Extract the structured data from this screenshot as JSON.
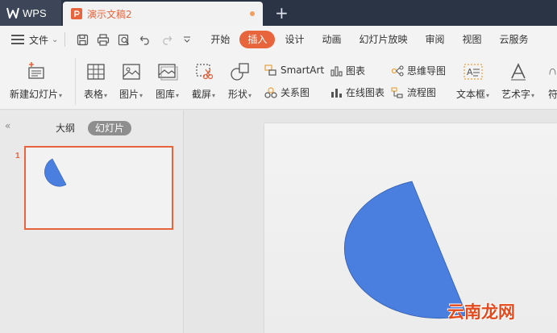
{
  "titlebar": {
    "app_name": "WPS",
    "document_title": "演示文稿2",
    "new_tab_symbol": "+"
  },
  "menubar": {
    "file_label": "文件",
    "tabs": [
      {
        "label": "开始",
        "active": false
      },
      {
        "label": "插入",
        "active": true
      },
      {
        "label": "设计",
        "active": false
      },
      {
        "label": "动画",
        "active": false
      },
      {
        "label": "幻灯片放映",
        "active": false
      },
      {
        "label": "审阅",
        "active": false
      },
      {
        "label": "视图",
        "active": false
      },
      {
        "label": "云服务",
        "active": false
      }
    ]
  },
  "ribbon": {
    "new_slide": "新建幻灯片",
    "table": "表格",
    "picture": "图片",
    "gallery": "图库",
    "screenshot": "截屏",
    "shape": "形状",
    "smartart": "SmartArt",
    "relation": "关系图",
    "chart": "图表",
    "online_chart": "在线图表",
    "mindmap": "思维导图",
    "flowchart": "流程图",
    "textbox": "文本框",
    "wordart": "艺术字",
    "symbol_partial": "符"
  },
  "leftpanel": {
    "tab_outline": "大纲",
    "tab_slides": "幻灯片",
    "slide_number": "1"
  },
  "slide": {
    "shape_color": "#4a7fe0",
    "shape_type": "pie-sector"
  },
  "watermark": "云南龙网",
  "colors": {
    "accent": "#e8643c",
    "titlebar": "#2b3445",
    "shape_fill": "#4a7fe0"
  }
}
